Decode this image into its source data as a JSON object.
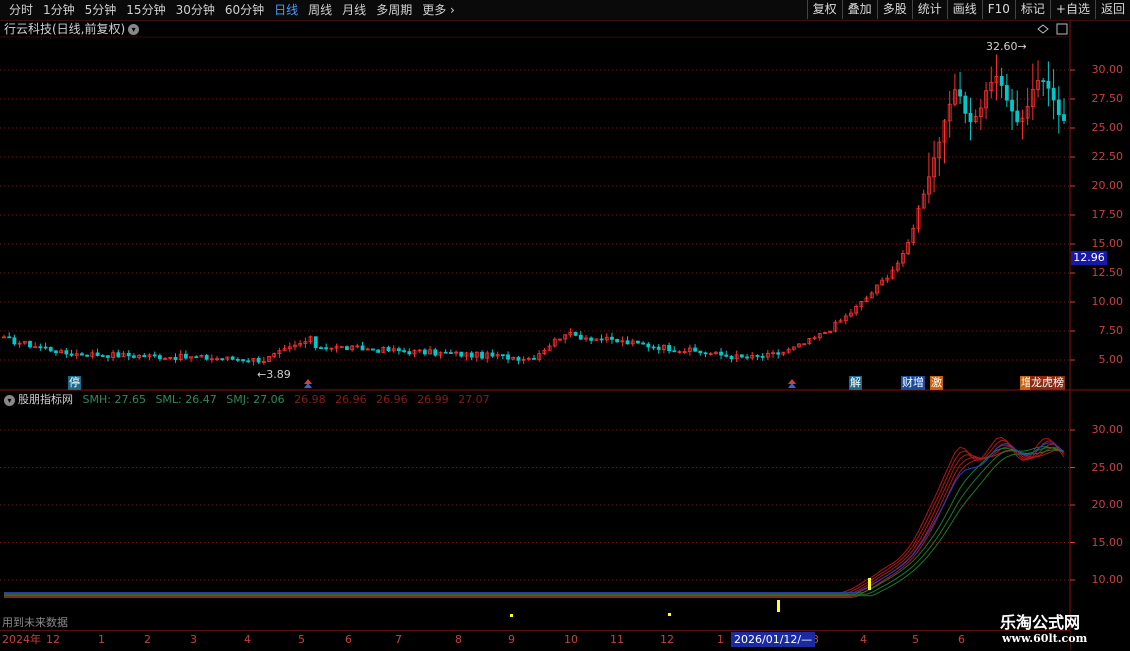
{
  "toolbar": {
    "periods": [
      "分时",
      "1分钟",
      "5分钟",
      "15分钟",
      "30分钟",
      "60分钟",
      "日线",
      "周线",
      "月线",
      "多周期",
      "更多"
    ],
    "active_period": "日线",
    "more_icon": "chevron-right-icon",
    "right_buttons": [
      "复权",
      "叠加",
      "多股",
      "统计",
      "画线",
      "F10",
      "标记",
      "+自选",
      "返回"
    ]
  },
  "main_panel": {
    "title": "行云科技(日线,前复权)",
    "title_icon": "chevron-down-icon",
    "high_annotation": "32.60",
    "low_annotation": "3.89",
    "current_price": "12.96",
    "axis_ticks": [
      "30.00",
      "27.50",
      "25.00",
      "22.50",
      "20.00",
      "17.50",
      "15.00",
      "12.50",
      "10.00",
      "7.50",
      "5.00"
    ],
    "event_tags": [
      "停",
      "解",
      "财增",
      "激",
      "增",
      "龙虎榜"
    ]
  },
  "indicator_panel": {
    "title": "股朋指标网",
    "title_icon": "chevron-down-icon",
    "legend": [
      {
        "text": "SMH: 27.65",
        "color": "#2e8b57"
      },
      {
        "text": "SML: 26.47",
        "color": "#2e8b57"
      },
      {
        "text": "SMJ: 27.06",
        "color": "#2e8b57"
      },
      {
        "text": "26.98",
        "color": "#8b1a1a"
      },
      {
        "text": "26.96",
        "color": "#8b1a1a"
      },
      {
        "text": "26.96",
        "color": "#8b1a1a"
      },
      {
        "text": "26.99",
        "color": "#8b1a1a"
      },
      {
        "text": "27.07",
        "color": "#8b1a1a"
      }
    ],
    "axis_ticks": [
      "30.00",
      "25.00",
      "20.00",
      "15.00",
      "10.00"
    ],
    "future_note": "用到未来数据"
  },
  "datebar": {
    "labels": [
      "2024年",
      "12",
      "1",
      "2",
      "3",
      "4",
      "5",
      "6",
      "7",
      "8",
      "9",
      "10",
      "11",
      "12",
      "1",
      "3",
      "4",
      "5",
      "6"
    ],
    "cursor_date": "2026/01/12/—"
  },
  "watermark": {
    "line1": "乐淘公式网",
    "line2": "www.60lt.com"
  },
  "colors": {
    "up": "#ff3030",
    "down": "#00c8c8",
    "grid": "#7a1010",
    "axis_text": "#c84040",
    "active": "#4a9cff"
  }
}
